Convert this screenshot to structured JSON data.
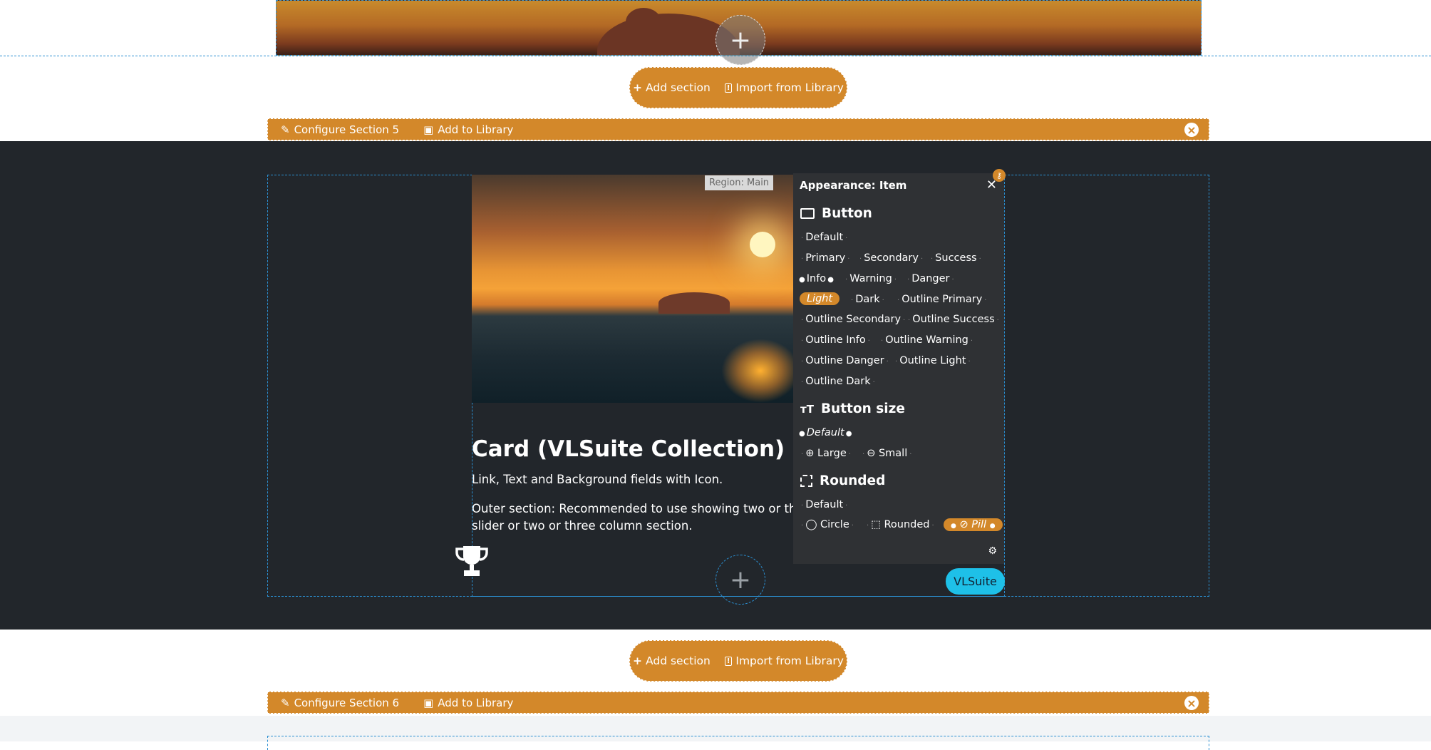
{
  "add_section_bar": {
    "add_label": "Add section",
    "import_label": "Import from Library"
  },
  "section5": {
    "configure_label": "Configure Section 5",
    "library_label": "Add to Library"
  },
  "section6": {
    "configure_label": "Configure Section 6",
    "library_label": "Add to Library"
  },
  "region_label": "Region: Main",
  "card": {
    "title": "Card (VLSuite Collection) - Cu",
    "subtitle": "Link, Text and Background fields with Icon.",
    "description_line1": "Outer section: Recommended to use showing two or three e",
    "description_line2": "slider or two or three column section."
  },
  "panel": {
    "title": "Appearance: Item",
    "button_heading": "Button",
    "button_options": [
      "Default",
      "Primary",
      "Secondary",
      "Success",
      "Info",
      "Warning",
      "Danger",
      "Light",
      "Dark",
      "Outline Primary",
      "Outline Secondary",
      "Outline Success",
      "Outline Info",
      "Outline Warning",
      "Outline Danger",
      "Outline Light",
      "Outline Dark"
    ],
    "button_current": "Info",
    "button_selected": "Light",
    "size_heading": "Button size",
    "size_options": [
      "Default",
      "Large",
      "Small"
    ],
    "size_current": "Default",
    "rounded_heading": "Rounded",
    "rounded_options": [
      "Default",
      "Circle",
      "Rounded",
      "Pill"
    ],
    "rounded_selected": "Pill"
  },
  "vlsuite_label": "VLSuite",
  "colors": {
    "accent": "#d3882a",
    "dark_bg": "#22262b",
    "panel_bg": "#2f3134",
    "vlsuite": "#1ec0e8"
  },
  "icons": [
    "plus-icon",
    "import-icon",
    "pencil-icon",
    "save-icon",
    "close-icon",
    "trophy-icon",
    "key-icon",
    "button-icon",
    "text-size-icon",
    "rounded-corner-icon",
    "zoom-in-icon",
    "zoom-out-icon",
    "circle-icon",
    "link-icon",
    "gear-icon"
  ]
}
